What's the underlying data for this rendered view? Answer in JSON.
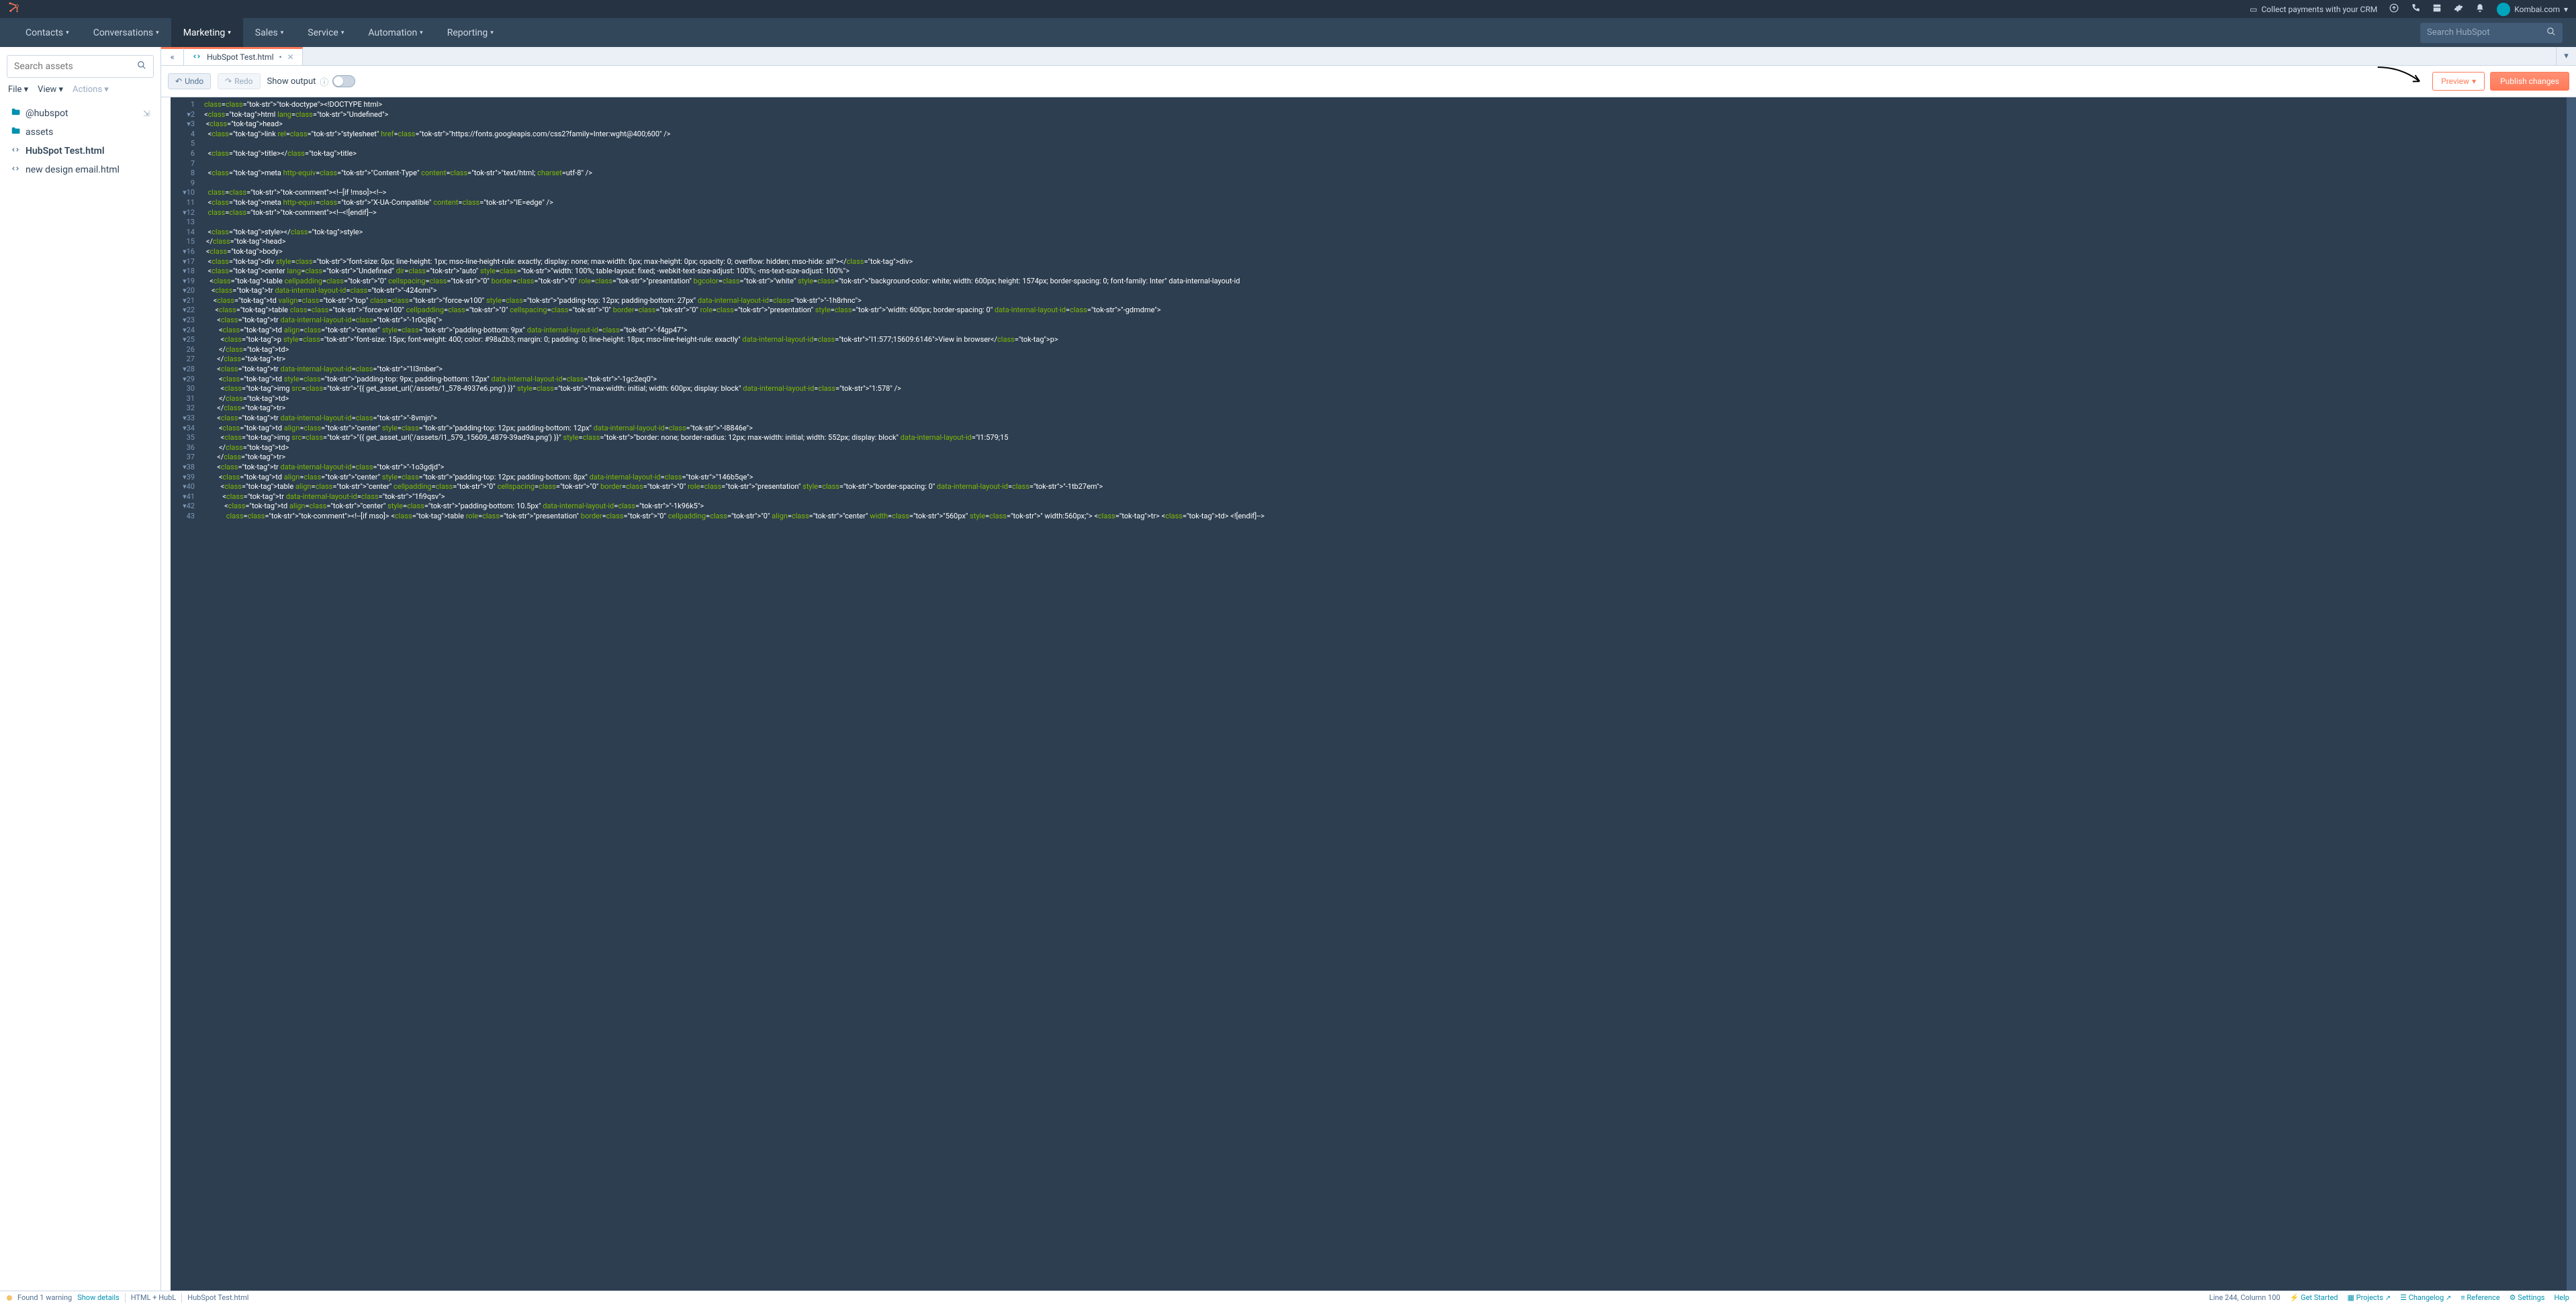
{
  "topbar": {
    "collect_label": "Collect payments with your CRM",
    "account_name": "Kombai.com"
  },
  "nav": {
    "items": [
      {
        "label": "Contacts",
        "active": false
      },
      {
        "label": "Conversations",
        "active": false
      },
      {
        "label": "Marketing",
        "active": true
      },
      {
        "label": "Sales",
        "active": false
      },
      {
        "label": "Service",
        "active": false
      },
      {
        "label": "Automation",
        "active": false
      },
      {
        "label": "Reporting",
        "active": false
      }
    ],
    "search_placeholder": "Search HubSpot"
  },
  "sidebar": {
    "search_placeholder": "Search assets",
    "menus": {
      "file": "File",
      "view": "View",
      "actions": "Actions"
    },
    "tree": [
      {
        "type": "folder",
        "label": "@hubspot"
      },
      {
        "type": "folder",
        "label": "assets"
      },
      {
        "type": "file",
        "label": "HubSpot Test.html",
        "selected": true
      },
      {
        "type": "file",
        "label": "new design email.html"
      }
    ]
  },
  "tab": {
    "label": "HubSpot Test.html",
    "dirty_mark": "•"
  },
  "toolbar": {
    "undo": "Undo",
    "redo": "Redo",
    "show_output": "Show output",
    "preview": "Preview",
    "publish": "Publish changes"
  },
  "code_lines": [
    "<!DOCTYPE html>",
    "<html lang=\"Undefined\">",
    " <head>",
    "  <link rel=\"stylesheet\" href=\"https://fonts.googleapis.com/css2?family=Inter:wght@400;600\" />",
    "",
    "  <title></title>",
    "",
    "  <meta http-equiv=\"Content-Type\" content=\"text/html; charset=utf-8\" />",
    "",
    "  <!--[if !mso]><!-->",
    "  <meta http-equiv=\"X-UA-Compatible\" content=\"IE=edge\" />",
    "  <!--<![endif]-->",
    "",
    "  <style></style>",
    " </head>",
    " <body>",
    "  <div style=\"font-size: 0px; line-height: 1px; mso-line-height-rule: exactly; display: none; max-width: 0px; max-height: 0px; opacity: 0; overflow: hidden; mso-hide: all\"></div>",
    "  <center lang=\"Undefined\" dir=\"auto\" style=\"width: 100%; table-layout: fixed; -webkit-text-size-adjust: 100%; -ms-text-size-adjust: 100%\">",
    "   <table cellpadding=\"0\" cellspacing=\"0\" border=\"0\" role=\"presentation\" bgcolor=\"white\" style=\"background-color: white; width: 600px; height: 1574px; border-spacing: 0; font-family: Inter\" data-internal-layout-id",
    "    <tr data-internal-layout-id=\"-424omi\">",
    "     <td valign=\"top\" class=\"force-w100\" style=\"padding-top: 12px; padding-bottom: 27px\" data-internal-layout-id=\"-1h8rhnc\">",
    "      <table class=\"force-w100\" cellpadding=\"0\" cellspacing=\"0\" border=\"0\" role=\"presentation\" style=\"width: 600px; border-spacing: 0\" data-internal-layout-id=\"-gdmdme\">",
    "       <tr data-internal-layout-id=\"-1r0cj8q\">",
    "        <td align=\"center\" style=\"padding-bottom: 9px\" data-internal-layout-id=\"-f4gp47\">",
    "         <p style=\"font-size: 15px; font-weight: 400; color: #98a2b3; margin: 0; padding: 0; line-height: 18px; mso-line-height-rule: exactly\" data-internal-layout-id=\"I1:577;15609:6146\">View in browser</p>",
    "        </td>",
    "       </tr>",
    "       <tr data-internal-layout-id=\"1l3mber\">",
    "        <td style=\"padding-top: 9px; padding-bottom: 12px\" data-internal-layout-id=\"-1gc2eq0\">",
    "         <img src=\"{{ get_asset_url('/assets/1_578-4937e6.png') }}\" style=\"max-width: initial; width: 600px; display: block\" data-internal-layout-id=\"1:578\" />",
    "        </td>",
    "       </tr>",
    "       <tr data-internal-layout-id=\"-8vmjn\">",
    "        <td align=\"center\" style=\"padding-top: 12px; padding-bottom: 12px\" data-internal-layout-id=\"-l8846e\">",
    "         <img src=\"{{ get_asset_url('/assets/I1_579_15609_4879-39ad9a.png') }}\" style=\"border: none; border-radius: 12px; max-width: initial; width: 552px; display: block\" data-internal-layout-id=\"I1:579;15",
    "        </td>",
    "       </tr>",
    "       <tr data-internal-layout-id=\"-1o3gdjd\">",
    "        <td align=\"center\" style=\"padding-top: 12px; padding-bottom: 8px\" data-internal-layout-id=\"146b5qe\">",
    "         <table align=\"center\" cellpadding=\"0\" cellspacing=\"0\" border=\"0\" role=\"presentation\" style=\"border-spacing: 0\" data-internal-layout-id=\"-1tb27em\">",
    "          <tr data-internal-layout-id=\"1fi9qsv\">",
    "           <td align=\"center\" style=\"padding-bottom: 10.5px\" data-internal-layout-id=\"-1k96k5\">",
    "            <!--[if mso]> <table role=\"presentation\" border=\"0\" cellpadding=\"0\" align=\"center\" width=\"560px\" style=\" width:560px;\"> <tr> <td> <![endif]-->"
  ],
  "statusbar": {
    "warning": "Found 1 warning",
    "show_details": "Show details",
    "lang": "HTML + HubL",
    "filename": "HubSpot Test.html",
    "cursor": "Line 244, Column 100",
    "get_started": "Get Started",
    "projects": "Projects",
    "changelog": "Changelog",
    "reference": "Reference",
    "settings": "Settings",
    "help": "Help"
  }
}
